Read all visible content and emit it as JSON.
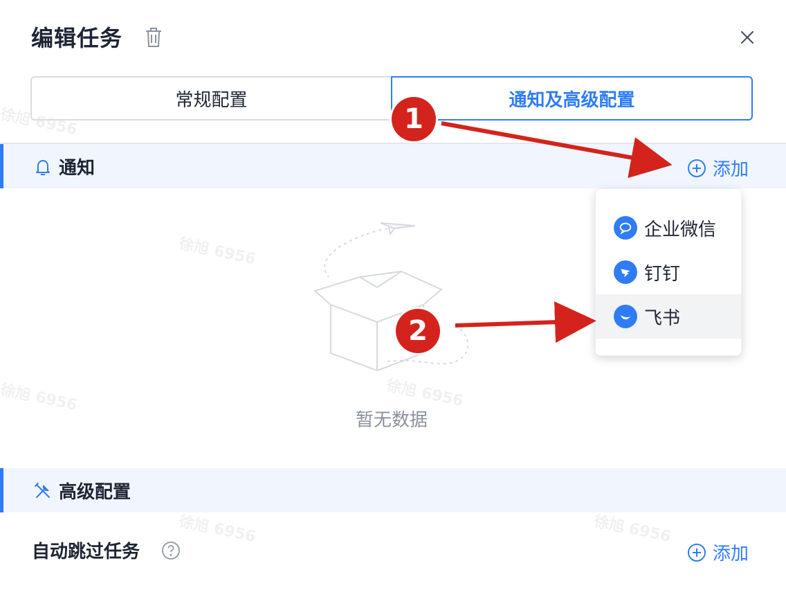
{
  "dialog": {
    "title": "编辑任务"
  },
  "tabs": [
    {
      "label": "常规配置",
      "active": false
    },
    {
      "label": "通知及高级配置",
      "active": true
    }
  ],
  "notify_section": {
    "title": "通知",
    "add_label": "添加",
    "empty_text": "暂无数据"
  },
  "dropdown": {
    "items": [
      {
        "label": "企业微信",
        "icon": "wecom-icon"
      },
      {
        "label": "钉钉",
        "icon": "dingtalk-icon"
      },
      {
        "label": "飞书",
        "icon": "feishu-icon",
        "hovered": true
      }
    ]
  },
  "advanced_section": {
    "title": "高级配置",
    "setting_label": "自动跳过任务",
    "add_label": "添加"
  },
  "watermark_text": "徐旭 6956",
  "annotations": {
    "step1": "1",
    "step2": "2"
  },
  "colors": {
    "accent": "#2f7cf6",
    "section_bg": "#f1f6fe",
    "annotation": "#d4231c"
  }
}
